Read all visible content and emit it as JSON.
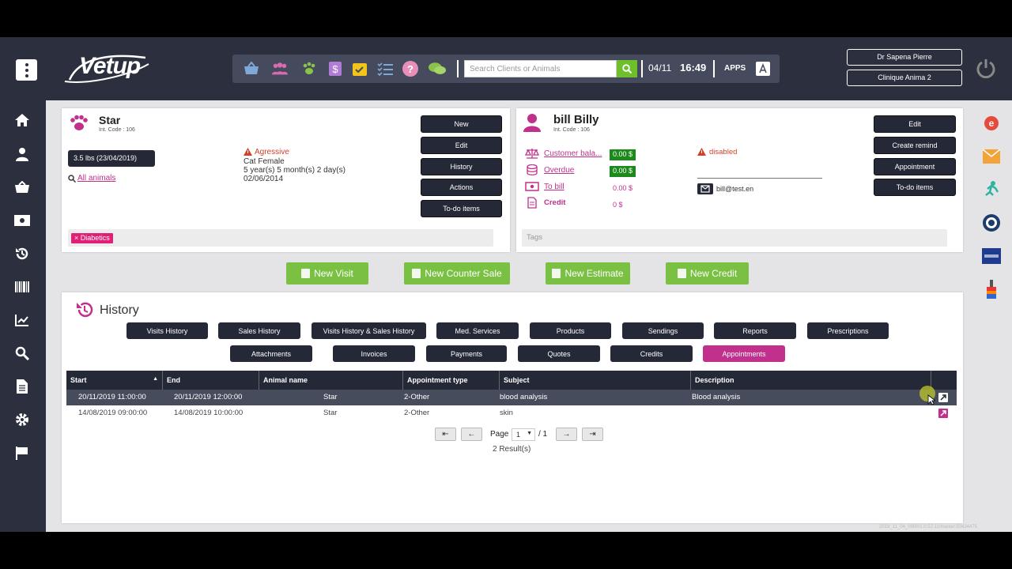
{
  "header": {
    "logo": "Vetup",
    "search_placeholder": "Search Clients or Animals",
    "date": "04/11",
    "time": "16:49",
    "apps_label": "APPS",
    "user_name": "Dr Sapena Pierre",
    "clinic_name": "Clinique Anima 2"
  },
  "animal": {
    "name": "Star",
    "int_code": "Int. Code : 106",
    "weight": "3.5 lbs (23/04/2019)",
    "all_animals": "All animals",
    "alert": "Agressive",
    "species": "Cat Female",
    "age": "5 year(s) 5 month(s) 2 day(s)",
    "birth": "02/06/2014",
    "tag": "Diabetics",
    "buttons": [
      "New",
      "Edit",
      "History",
      "Actions",
      "To-do items"
    ]
  },
  "client": {
    "name": "bill Billy",
    "int_code": "Int. Code : 106",
    "customer_balance_label": "Customer bala...",
    "customer_balance": "0.00 $",
    "overdue_label": "Overdue",
    "overdue": "0.00 $",
    "to_bill_label": "To bill",
    "to_bill": "0.00 $",
    "credit_label": "Credit",
    "credit": "0 $",
    "status": "disabled",
    "email": "bill@test.en",
    "tags_placeholder": "Tags",
    "buttons": [
      "Edit",
      "Create remind",
      "Appointment",
      "To-do items"
    ]
  },
  "actions": [
    "New Visit",
    "New Counter Sale",
    "New Estimate",
    "New Credit"
  ],
  "history": {
    "title": "History",
    "tabs_row1": [
      "Visits History",
      "Sales History",
      "Visits History & Sales History",
      "Med. Services",
      "Products",
      "Sendings",
      "Reports",
      "Prescriptions"
    ],
    "tabs_row2": [
      "Attachments",
      "Invoices",
      "Payments",
      "Quotes",
      "Credits",
      "Appointments"
    ],
    "columns": [
      "Start",
      "End",
      "Animal name",
      "Appointment type",
      "Subject",
      "Description"
    ],
    "rows": [
      [
        "20/11/2019 11:00:00",
        "20/11/2019 12:00:00",
        "Star",
        "2-Other",
        "blood analysis",
        "Blood analysis"
      ],
      [
        "14/08/2019 09:00:00",
        "14/08/2019 10:00:00",
        "Star",
        "2-Other",
        "skin",
        ""
      ]
    ],
    "page_label": "Page",
    "page": "1",
    "page_total": "/ 1",
    "results": "2 Result(s)"
  },
  "footer_version": "2019_11_04_0900/1.0.52.11/master.93424475",
  "colors": {
    "accent": "#c0308c",
    "green": "#7ac143",
    "dark": "#2b2f3e"
  }
}
